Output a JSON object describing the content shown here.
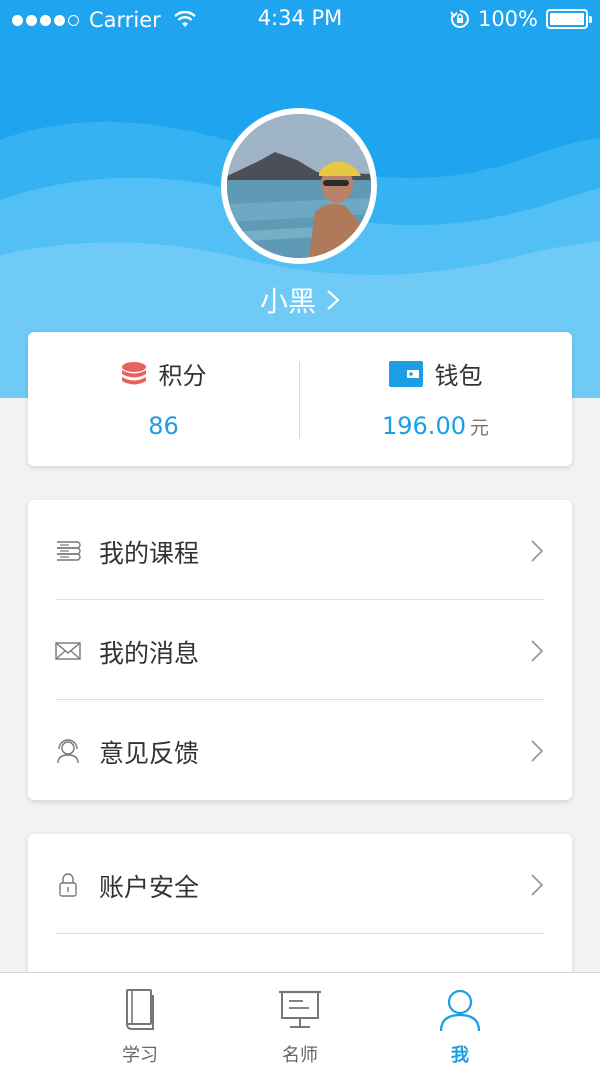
{
  "status_bar": {
    "carrier": "Carrier",
    "time": "4:34 PM",
    "battery": "100%"
  },
  "profile": {
    "username": "小黑"
  },
  "stats": {
    "points_label": "积分",
    "points_value": "86",
    "wallet_label": "钱包",
    "wallet_value": "196.00",
    "wallet_unit": "元"
  },
  "menu": {
    "items": [
      {
        "label": "我的课程",
        "icon": "courses-icon"
      },
      {
        "label": "我的消息",
        "icon": "mail-icon"
      },
      {
        "label": "意见反馈",
        "icon": "feedback-icon"
      },
      {
        "label": "账户安全",
        "icon": "lock-icon"
      }
    ]
  },
  "tabbar": {
    "tabs": [
      {
        "label": "学习",
        "icon": "book-icon"
      },
      {
        "label": "名师",
        "icon": "teacher-board-icon"
      },
      {
        "label": "我",
        "icon": "person-icon"
      }
    ],
    "active": "我"
  },
  "colors": {
    "primary": "#1c9de6",
    "header_top": "#1fa5ef",
    "header_wave": "#6fcaf6",
    "points_icon": "#e8615c"
  }
}
